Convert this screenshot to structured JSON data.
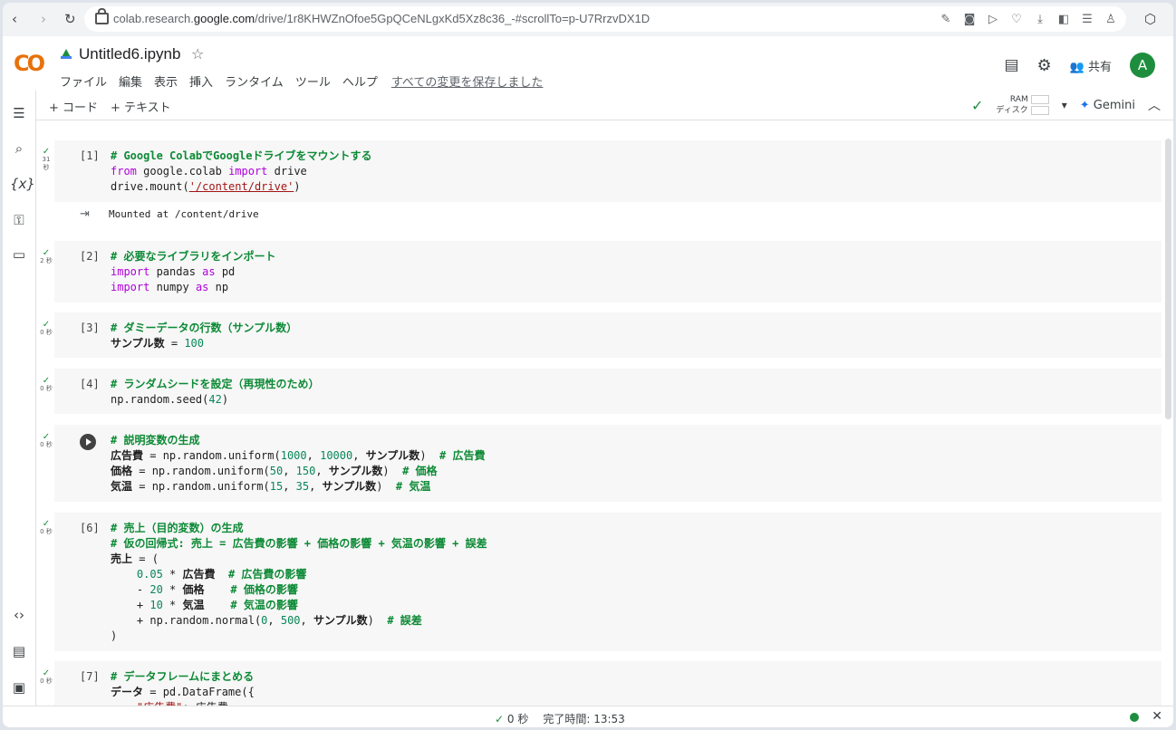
{
  "browser": {
    "url_prefix": "colab.research.",
    "url_domain": "google.com",
    "url_suffix": "/drive/1r8KHWZnOfoe5GpQCeNLgxKd5Xz8c36_-#scrollTo=p-U7RrzvDX1D",
    "back": "‹",
    "forward": "›",
    "reload": "↻"
  },
  "header": {
    "logo": "CO",
    "title": "Untitled6.ipynb",
    "star": "☆",
    "menu": [
      "ファイル",
      "編集",
      "表示",
      "挿入",
      "ランタイム",
      "ツール",
      "ヘルプ"
    ],
    "saved_status": "すべての変更を保存しました",
    "share_label": "共有",
    "avatar_letter": "A"
  },
  "toolbar": {
    "add_code": "+ コード",
    "add_text": "+ テキスト",
    "ram_label": "RAM",
    "disk_label": "ディスク",
    "gemini_label": "Gemini"
  },
  "cells": {
    "c1": {
      "prompt": "[1]",
      "time_a": "31",
      "time_b": "秒"
    },
    "c2": {
      "prompt": "[2]",
      "time": "2 秒"
    },
    "c3": {
      "prompt": "[3]",
      "time": "0 秒"
    },
    "c4": {
      "prompt": "[4]",
      "time": "0 秒"
    },
    "c5": {
      "time": "0 秒"
    },
    "c6": {
      "prompt": "[6]",
      "time": "0 秒"
    },
    "c7": {
      "prompt": "[7]",
      "time": "0 秒"
    },
    "output1": "Mounted at /content/drive"
  },
  "status": {
    "elapsed": "0 秒",
    "completed": "完了時間: 13:53"
  },
  "colors": {
    "accent": "#1e8e3e",
    "brand_orange": "#f9ab00"
  }
}
